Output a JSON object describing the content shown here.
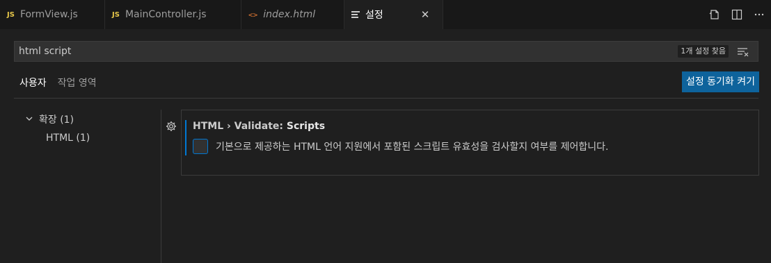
{
  "tabs": [
    {
      "icon": "JS",
      "label": "FormView.js"
    },
    {
      "icon": "JS",
      "label": "MainController.js"
    },
    {
      "icon": "<>",
      "label": "index.html"
    },
    {
      "label": "설정",
      "close": "✕"
    }
  ],
  "search": {
    "value": "html script",
    "results_badge": "1개 설정 찾음"
  },
  "scope_tabs": [
    "사용자",
    "작업 영역"
  ],
  "sync_button": "설정 동기화 켜기",
  "toc": {
    "group": "확장 (1)",
    "child": "HTML (1)"
  },
  "setting": {
    "category": "HTML › Validate: ",
    "name": "Scripts",
    "description": "기본으로 제공하는 HTML 언어 지원에서 포함된 스크립트 유효성을 검사할지 여부를 제어합니다.",
    "checked": false
  },
  "colors": {
    "accent": "#0078d4",
    "button": "#0e639c",
    "js_icon": "#e8c84a",
    "html_icon": "#e37933"
  }
}
